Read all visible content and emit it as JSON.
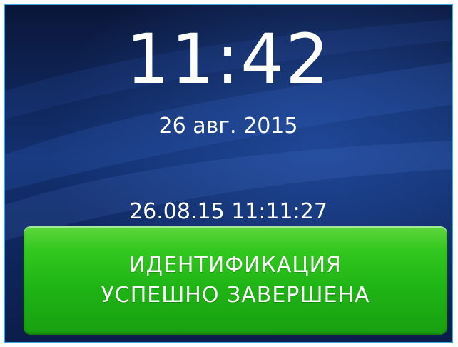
{
  "clock": {
    "time": "11:42",
    "date": "26 авг. 2015"
  },
  "event": {
    "timestamp": "26.08.15 11:11:27"
  },
  "status": {
    "line1": "ИДЕНТИФИКАЦИЯ",
    "line2": "УСПЕШНО ЗАВЕРШЕНА",
    "color": "#22b81a"
  },
  "colors": {
    "background": "#0b1a44",
    "frame_border": "#3fa6e0",
    "text": "#ffffff"
  }
}
